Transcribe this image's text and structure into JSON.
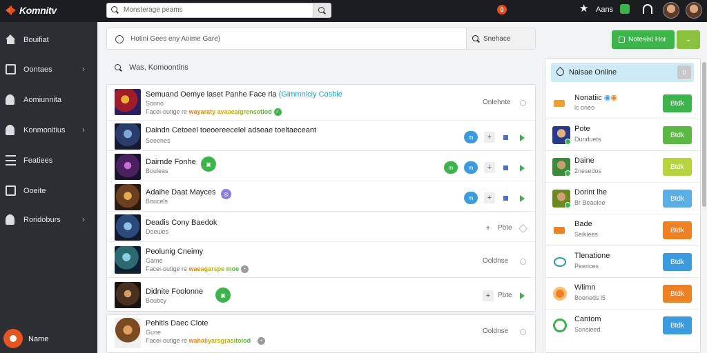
{
  "app": {
    "logo_text": "Komnitv"
  },
  "topbar": {
    "search_placeholder": "Monsterage peams",
    "user_label": "Aans",
    "alert_badge": "0"
  },
  "sidebar": {
    "items": [
      {
        "label": "Bouifiat",
        "icon": "home-icon",
        "chevron": false
      },
      {
        "label": "Oontaes",
        "icon": "inbox-icon",
        "chevron": true
      },
      {
        "label": "Aomiunnita",
        "icon": "puzzle-icon",
        "chevron": false
      },
      {
        "label": "Konmonitius",
        "icon": "people-icon",
        "chevron": true
      },
      {
        "label": "Featiees",
        "icon": "list-icon",
        "chevron": false
      },
      {
        "label": "Ooeite",
        "icon": "monitor-icon",
        "chevron": false
      },
      {
        "label": "Roridoburs",
        "icon": "network-icon",
        "chevron": true
      }
    ],
    "user_name": "Name"
  },
  "main": {
    "search_placeholder": "Hotini Gees eny Aoime Gare)",
    "search_button": "Snehace",
    "section_title": "Was, Komoontins",
    "rows": [
      {
        "title": "Semuand Oemye laset Panhe Face rla",
        "title_hl": "(Gimmniciy Coshie",
        "sub": "Facei-outige re",
        "sub_grad": "wayaraty avaaeaigrensotiod",
        "status": "Onlehnte",
        "avatar": "armor-red"
      },
      {
        "title": "Daindn Cetoeel toeoereecelel adseae toeltaeceant",
        "sub": "Seeenes",
        "actions": "blue-plus-square-arrow",
        "avatar": "knight-blue"
      },
      {
        "title": "Dairnde Fonhe",
        "sub": "Bouleas",
        "actions": "green-blue-plus-square-arrow",
        "avatar": "mage-purple"
      },
      {
        "title": "Adaihe Daat Mayces",
        "sub": "Boucels",
        "actions": "blue-plus-square-arrow",
        "avatar": "warrior-gold"
      },
      {
        "title": "Deadis Cony Baedok",
        "sub": "Doeuies",
        "status": "Pbte",
        "avatar": "soldier-blue"
      },
      {
        "title": "Peolunig Cneimy",
        "sub": "Game",
        "sub2": "Facei-outige re",
        "sub_grad": "waeagarspe moe",
        "status": "Ooldnse",
        "avatar": "hero-green"
      },
      {
        "title": "Didnite Foolonne",
        "sub": "Boubcy",
        "status": "Pbte",
        "avatar": "rogue-dark"
      },
      {
        "title": "Pehitis Daec Clote",
        "sub": "Gune",
        "sub2": "Facei-outige re",
        "sub_grad": "wahaliyarsgrasitoiod",
        "status": "Ooldnse",
        "avatar": "barbarian-brown"
      }
    ]
  },
  "right": {
    "notify_label": "Notesist Hor",
    "online_title": "Naisae Online",
    "online_badge": "0",
    "users": [
      {
        "name": "Nonatiic",
        "sub": "lc oneo",
        "button": "Btdk",
        "button_color": "#3bb54a",
        "avatar": "icon-orange"
      },
      {
        "name": "Pote",
        "sub": "Dunduets",
        "button": "Btdk",
        "button_color": "#5ab940",
        "avatar": "photo-blue"
      },
      {
        "name": "Daine",
        "sub": "2nesedos",
        "button": "Btdk",
        "button_color": "#b7d33a",
        "avatar": "photo-green"
      },
      {
        "name": "Dorint lhe",
        "sub": "Br Beaoloe",
        "button": "Btdk",
        "button_color": "#5aaee6",
        "avatar": "photo-gold"
      },
      {
        "name": "Bade",
        "sub": "Seiklees",
        "button": "Btdk",
        "button_color": "#f08020",
        "avatar": "icon-orange-sq"
      },
      {
        "name": "Tlenatione",
        "sub": "Peerices",
        "button": "Btdk",
        "button_color": "#3a9be0",
        "avatar": "icon-teal"
      },
      {
        "name": "Wlimn",
        "sub": "Boeneds l5",
        "button": "Btdk",
        "button_color": "#f08020",
        "avatar": "icon-orange-circle"
      },
      {
        "name": "Cantom",
        "sub": "Sonsieed",
        "button": "Btdk",
        "button_color": "#3a9be0",
        "avatar": "icon-green-chat"
      }
    ]
  },
  "colors": {
    "accent_green": "#3bb54a",
    "accent_blue": "#3a9be0",
    "accent_orange": "#f08020",
    "sidebar_bg": "#2b2e33",
    "topbar_bg": "#1c1d20"
  }
}
